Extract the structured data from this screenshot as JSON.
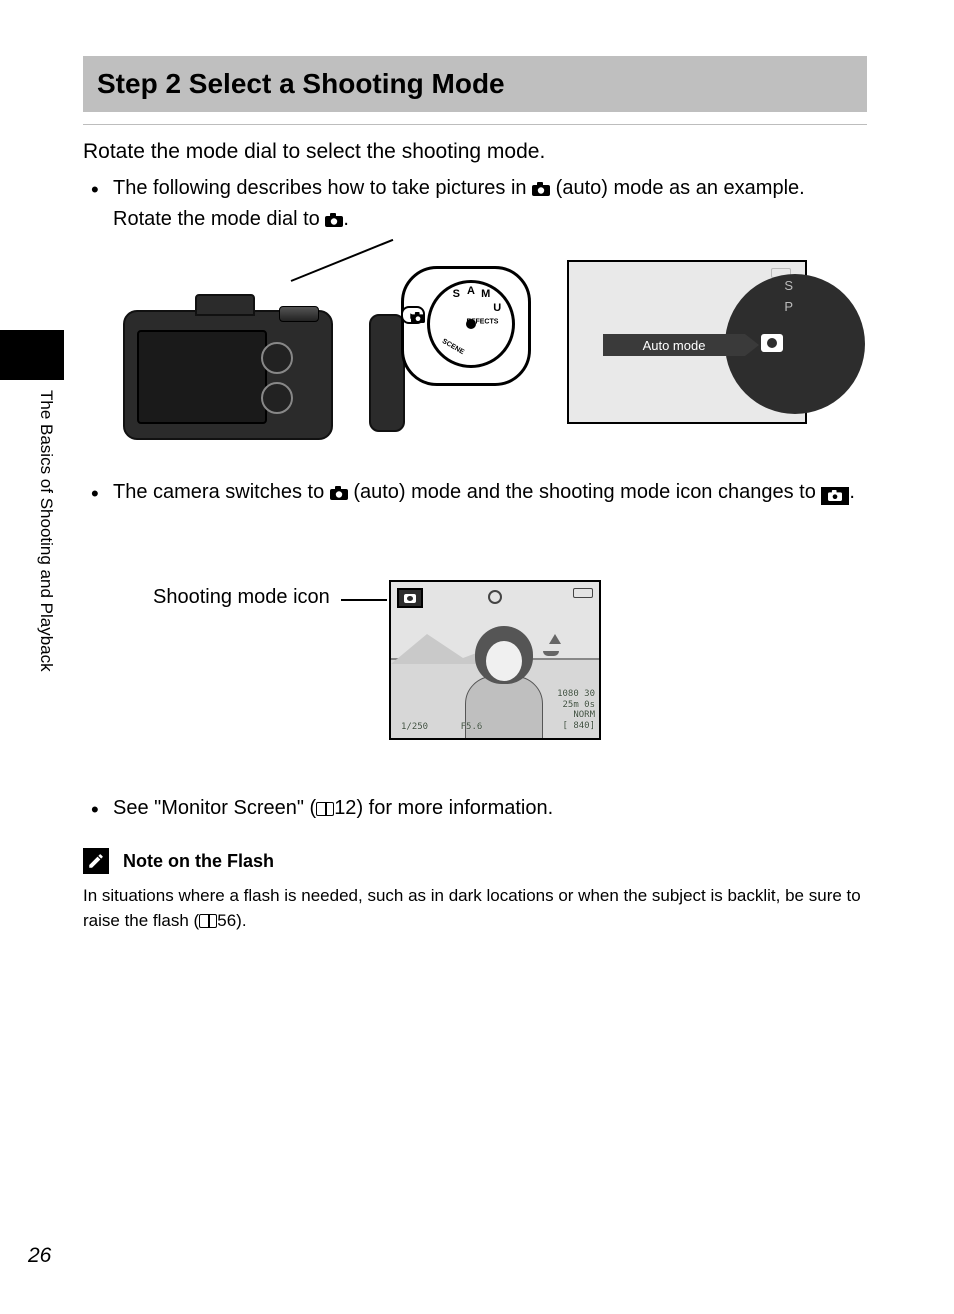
{
  "page_number": "26",
  "side_section": "The Basics of Shooting and Playback",
  "heading": "Step 2 Select a Shooting Mode",
  "lead": "Rotate the mode dial to select the shooting mode.",
  "bullet1_a": "The following describes how to take pictures in ",
  "bullet1_b": " (auto) mode as an example. Rotate the mode dial to ",
  "bullet1_c": ".",
  "bullet2_a": "The camera switches to ",
  "bullet2_b": " (auto) mode and the shooting mode icon changes to ",
  "bullet2_c": ".",
  "bullet3_a": "See \"Monitor Screen\" (",
  "bullet3_ref": "12",
  "bullet3_b": ") for more information.",
  "dial": {
    "letters": {
      "s": "S",
      "a": "A",
      "m": "M",
      "u": "U",
      "effects": "EFFECTS",
      "scene": "SCENE"
    }
  },
  "lcd": {
    "auto_label": "Auto mode",
    "s": "S",
    "p": "P"
  },
  "fig2_label": "Shooting mode icon",
  "screen": {
    "res": "1080 30",
    "time": "25m 0s",
    "quality": "NORM",
    "remaining": "[  840]",
    "shutter": "1/250",
    "aperture": "F5.6"
  },
  "note": {
    "title": "Note on the Flash",
    "text_a": "In situations where a flash is needed, such as in dark locations or when the subject is backlit, be sure to raise the flash (",
    "ref": "56",
    "text_b": ")."
  }
}
